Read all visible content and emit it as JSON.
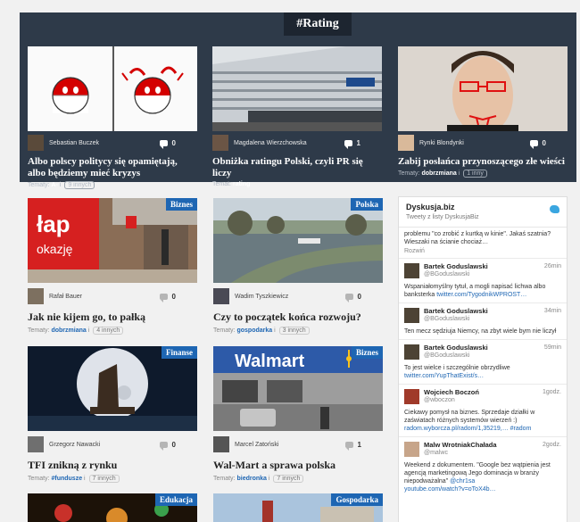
{
  "rating": {
    "tag": "#Rating",
    "cards": [
      {
        "author": "Sebastian Buczek",
        "comments": "0",
        "title": "Albo polscy politycy się opamiętają, albo będziemy mieć kryzys",
        "tags_label": "Tematy:",
        "tag1": "A-",
        "more": "9 innych"
      },
      {
        "author": "Magdalena Wierzchowska",
        "comments": "1",
        "title": "Obniżka ratingu Polski, czyli PR się liczy",
        "tags_label": "Temat:",
        "tag1": "rating",
        "more": ""
      },
      {
        "author": "Rynki Blondynki",
        "comments": "0",
        "title": "Zabij posłańca przynoszącego złe wieści",
        "tags_label": "Tematy:",
        "tag1": "dobrzmiana",
        "more": "1 inny"
      }
    ]
  },
  "articles": [
    {
      "badge": "Biznes",
      "author": "Rafał Bauer",
      "comments": "0",
      "title": "Jak nie kijem go, to pałką",
      "tags_label": "Tematy:",
      "tag1": "dobrzmiana",
      "more": "4 innych",
      "img_text": "łap okazję"
    },
    {
      "badge": "Polska",
      "author": "Wadim Tyszkiewicz",
      "comments": "0",
      "title": "Czy to początek końca rozwoju?",
      "tags_label": "Tematy:",
      "tag1": "gospodarka",
      "more": "3 innych"
    },
    {
      "badge": "Finanse",
      "author": "Grzegorz Nawacki",
      "comments": "0",
      "title": "TFI znikną z rynku",
      "tags_label": "Tematy:",
      "tag1": "#fundusze",
      "more": "7 innych"
    },
    {
      "badge": "Biznes",
      "author": "Marcel Zatoński",
      "comments": "1",
      "title": "Wal-Mart a sprawa polska",
      "tags_label": "Tematy:",
      "tag1": "biedronka",
      "more": "7 innych",
      "img_text": "Walmart"
    },
    {
      "badge": "Edukacja"
    },
    {
      "badge": "Gospodarka"
    }
  ],
  "twitter": {
    "title": "Dyskusja.biz",
    "subtitle": "Tweety z listy DyskusjaBiz",
    "partial_text": "problemu \"co zrobić z kurtką w kinie\". Jakaś szatnia? Wieszaki na ścianie chociaż…",
    "partial_expand": "Rozwiń",
    "tweets": [
      {
        "name": "Bartek Goduslawski",
        "handle": "@BGoduslawski",
        "time": "26min",
        "text": "Wspaniałomyślny tytuł, a mogli napisać lichwa albo banksterka",
        "link": "twitter.com/TygodnikWPROST…"
      },
      {
        "name": "Bartek Goduslawski",
        "handle": "@BGoduslawski",
        "time": "34min",
        "text": "Ten mecz sędziuja Niemcy, na zbyt wiele bym nie liczył",
        "link": ""
      },
      {
        "name": "Bartek Goduslawski",
        "handle": "@BGoduslawski",
        "time": "59min",
        "text": "To jest wielce i szczególnie obrzydliwe",
        "link": "twitter.com/YupThatExist/s…"
      },
      {
        "name": "Wojciech Boczoń",
        "handle": "@wboczon",
        "time": "1godz.",
        "text": "Ciekawy pomysł na biznes. Sprzedaje działki w zaświatach różnych systemów wierzeń :)",
        "link": "radom.wyborcza.pl/radom/1,35219,… #radom"
      },
      {
        "name": "Malw WrotniakChałada",
        "handle": "@malwc",
        "time": "2godz.",
        "text": "Weekend z dokumentem. \"Google bez wątpienia jest agencją marketingową Jego dominacja w branży niepodważalna\"",
        "link": "@chr1sa",
        "link2": "youtube.com/watch?v=oToX4b…"
      }
    ]
  }
}
